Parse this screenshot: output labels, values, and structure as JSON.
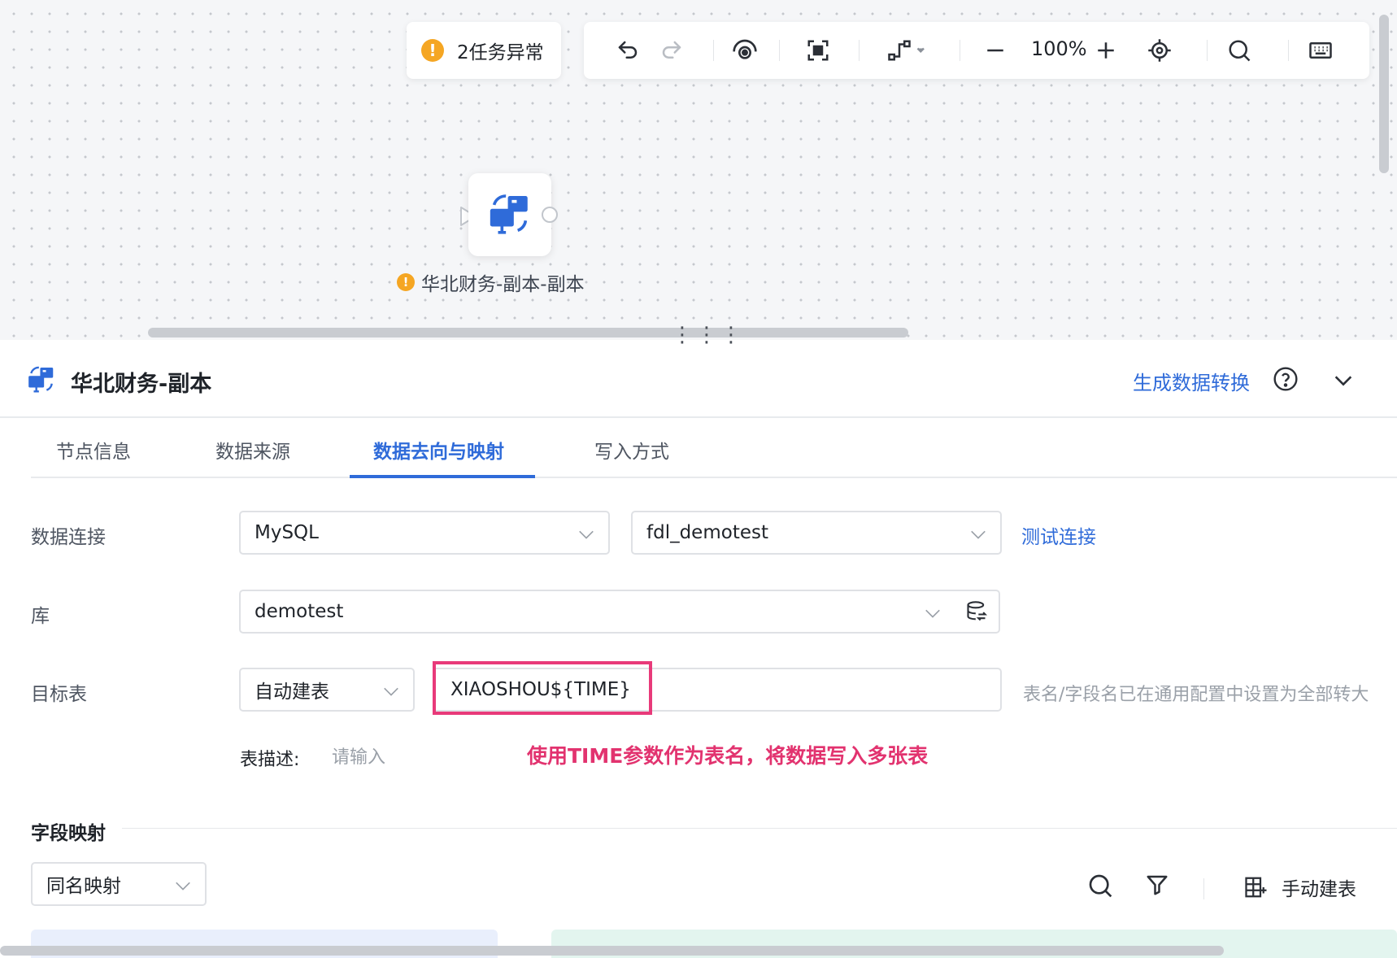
{
  "canvas": {
    "warning": {
      "text": "2任务异常",
      "icon": "warning-icon",
      "color": "#f5a623"
    },
    "toolbar": {
      "zoom": "100%",
      "icons": [
        "undo-icon",
        "redo-icon",
        "preview-icon",
        "fit-view-icon",
        "connector-icon",
        "zoom-out-icon",
        "zoom-in-icon",
        "locate-icon",
        "search-icon",
        "keyboard-icon"
      ]
    },
    "node": {
      "label": "华北财务-副本-副本"
    }
  },
  "panel": {
    "title": "华北财务-副本",
    "generate_link": "生成数据转换",
    "tabs": [
      {
        "label": "节点信息"
      },
      {
        "label": "数据来源"
      },
      {
        "label": "数据去向与映射",
        "active": true
      },
      {
        "label": "写入方式"
      }
    ],
    "connection": {
      "label": "数据连接",
      "db_type": "MySQL",
      "connection_name": "fdl_demotest",
      "test_link": "测试连接"
    },
    "database": {
      "label": "库",
      "value": "demotest"
    },
    "target_table": {
      "label": "目标表",
      "mode": "自动建表",
      "table_name": "XIAOSHOU${TIME}",
      "hint": "表名/字段名已在通用配置中设置为全部转大",
      "desc_label": "表描述:",
      "desc_placeholder": "请输入",
      "annotation": "使用TIME参数作为表名，将数据写入多张表"
    },
    "field_mapping": {
      "title": "字段映射",
      "mode": "同名映射",
      "manual_create": "手动建表"
    }
  },
  "colors": {
    "accent": "#2f6bd9",
    "annotation": "#e2336f",
    "highlight_border": "#e83a7a"
  }
}
